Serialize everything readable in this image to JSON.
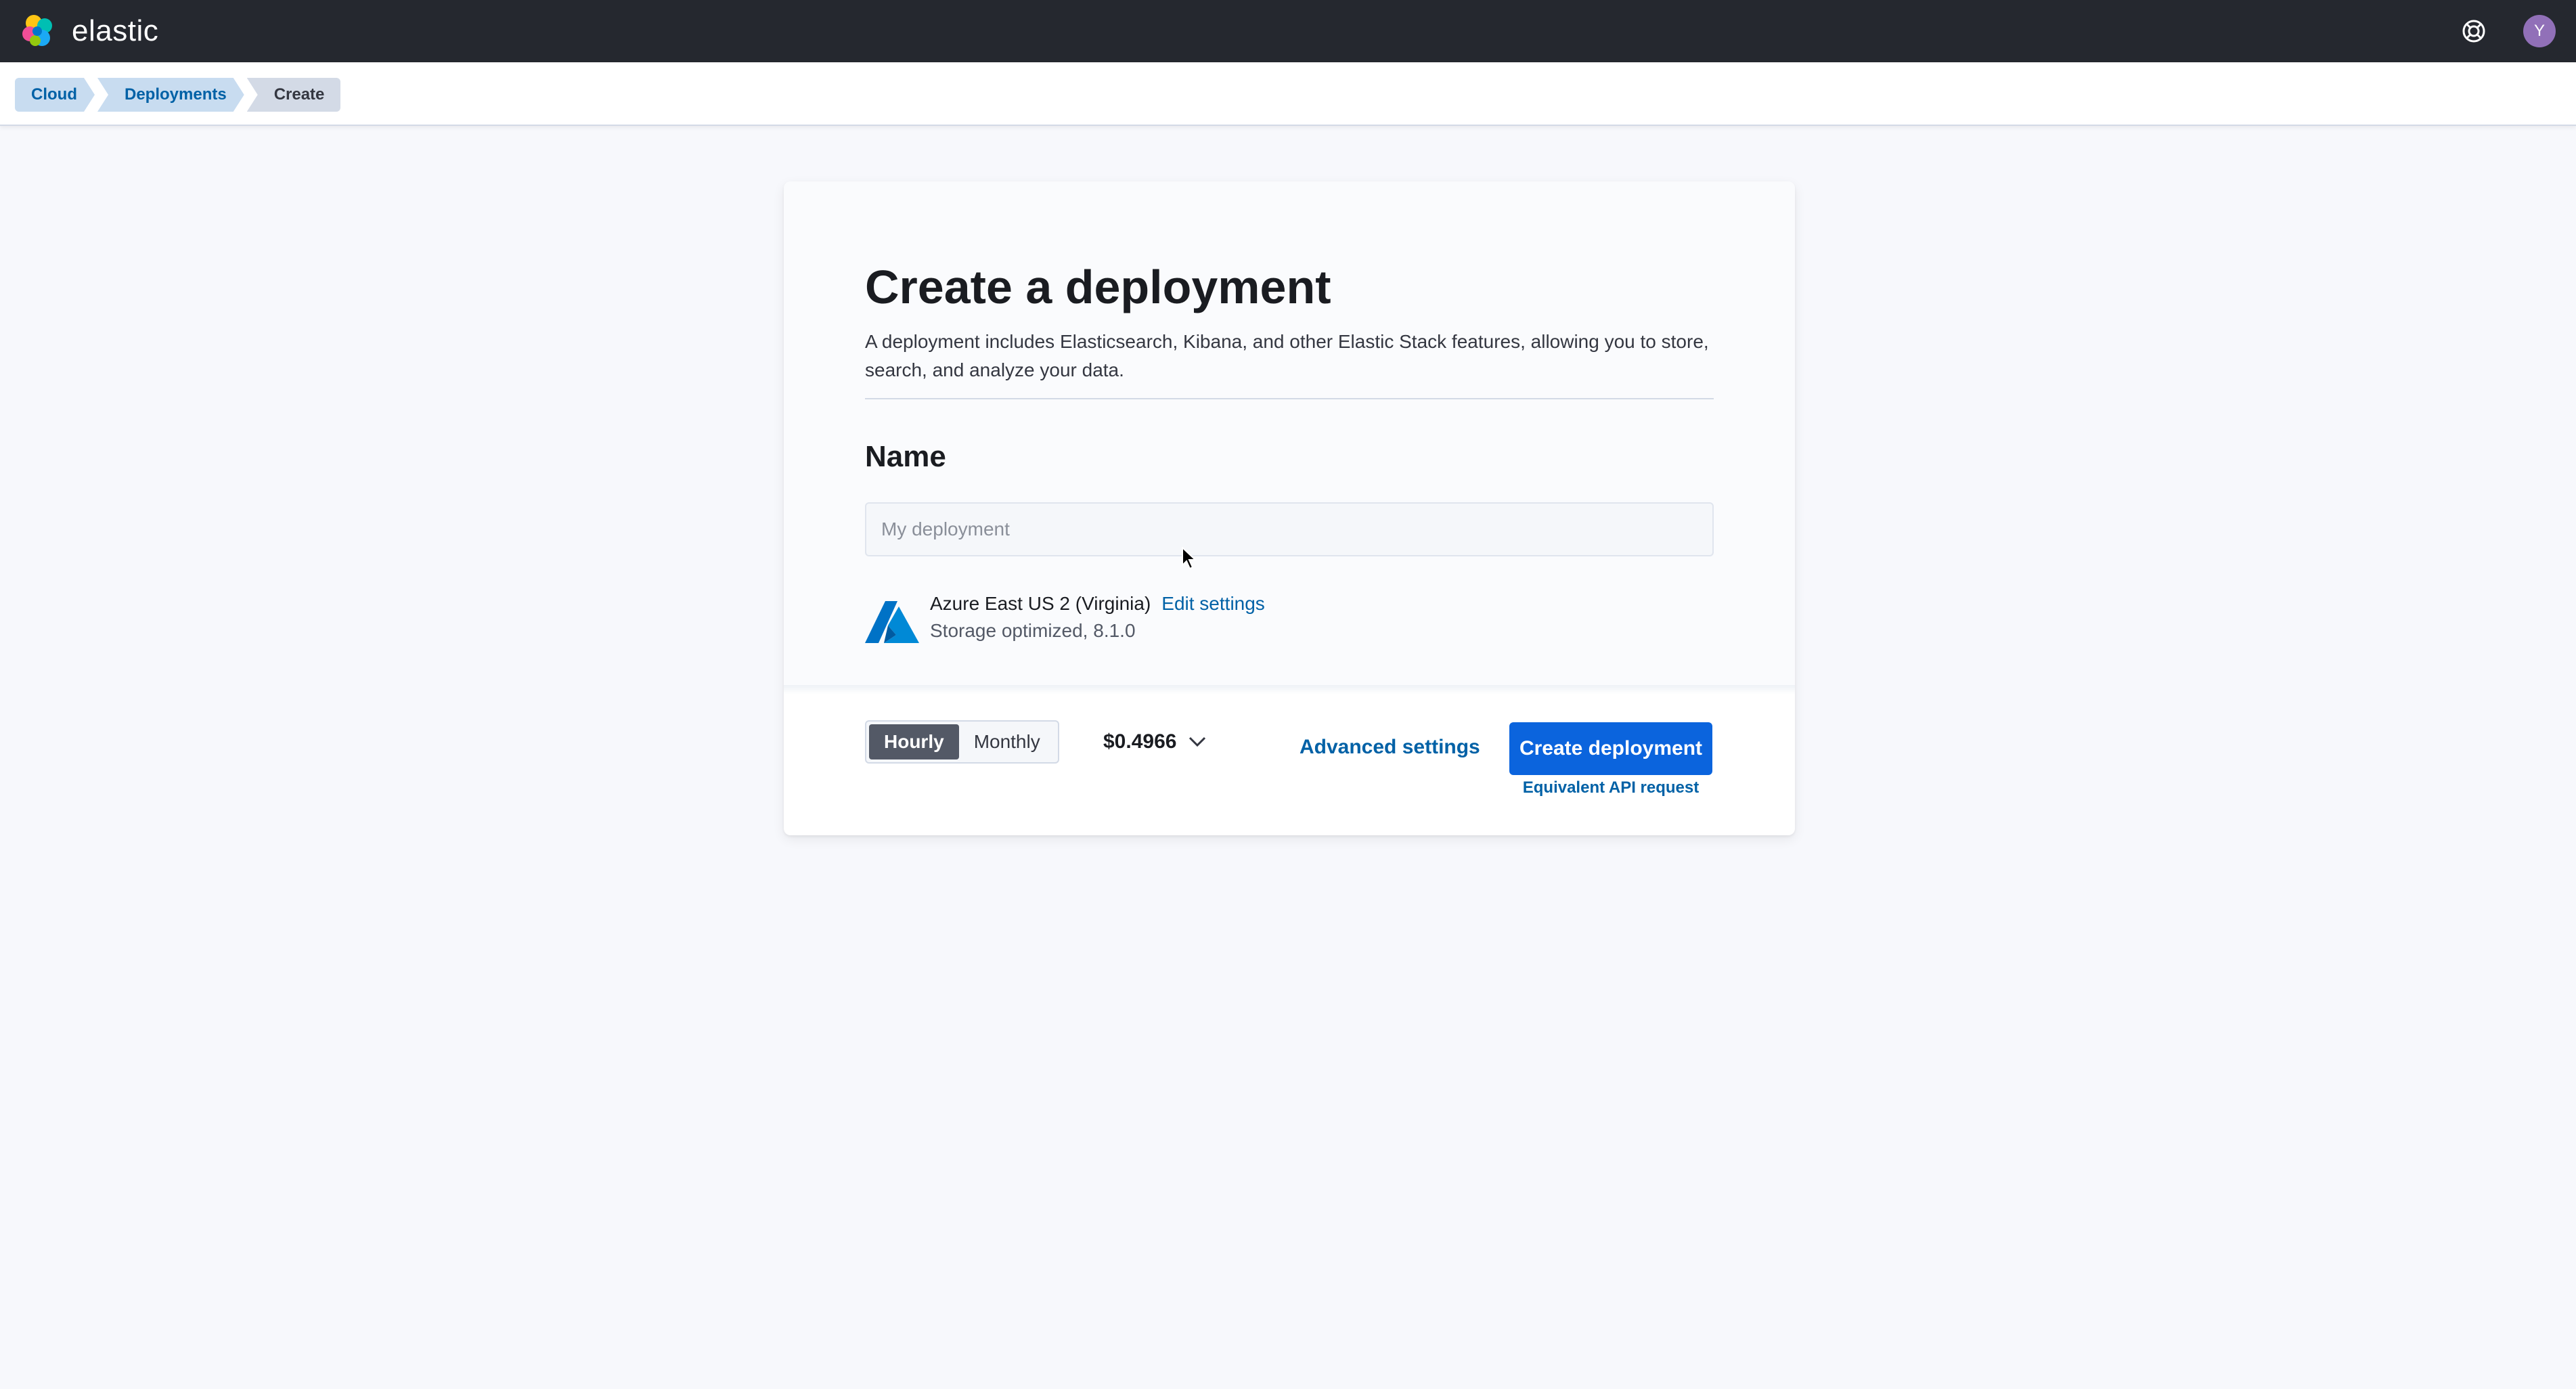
{
  "header": {
    "brand": "elastic",
    "logo_icon": "elastic-logo",
    "help_icon": "help-icon",
    "avatar_initial": "Y",
    "avatar_color": "#9170b8"
  },
  "breadcrumbs": [
    {
      "label": "Cloud"
    },
    {
      "label": "Deployments"
    },
    {
      "label": "Create"
    }
  ],
  "main": {
    "title": "Create a deployment",
    "description": "A deployment includes Elasticsearch, Kibana, and other Elastic Stack features, allowing you to store, search, and analyze your data.",
    "name_heading": "Name",
    "name_input": {
      "value": "",
      "placeholder": "My deployment"
    },
    "region": {
      "provider_icon": "azure-icon",
      "name": "Azure East US 2 (Virginia)",
      "edit_label": "Edit settings",
      "details": "Storage optimized, 8.1.0"
    }
  },
  "footer": {
    "billing_toggle": {
      "hourly": "Hourly",
      "monthly": "Monthly",
      "selected": "Hourly"
    },
    "price": "$0.4966",
    "advanced_settings": "Advanced settings",
    "create_button": "Create deployment",
    "api_request": "Equivalent API request"
  },
  "colors": {
    "header_bg": "#25282f",
    "primary": "#0b64dd",
    "link": "#0061a6"
  }
}
